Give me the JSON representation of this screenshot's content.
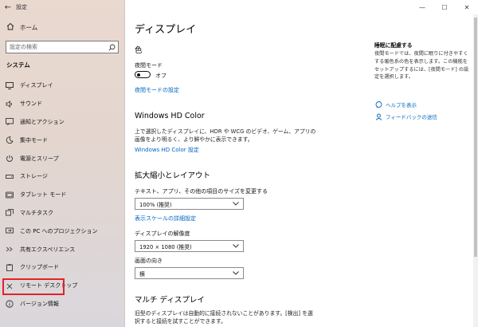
{
  "window": {
    "title": "設定",
    "back_icon": "arrow-left-icon",
    "minimize": "—",
    "maximize": "☐",
    "close": "✕"
  },
  "sidebar": {
    "home_label": "ホーム",
    "search_placeholder": "設定の検索",
    "section": "システム",
    "items": [
      {
        "label": "ディスプレイ",
        "icon": "display-icon"
      },
      {
        "label": "サウンド",
        "icon": "speaker-icon"
      },
      {
        "label": "通知とアクション",
        "icon": "notification-icon"
      },
      {
        "label": "集中モード",
        "icon": "moon-icon"
      },
      {
        "label": "電源とスリープ",
        "icon": "power-icon"
      },
      {
        "label": "ストレージ",
        "icon": "storage-icon"
      },
      {
        "label": "タブレット モード",
        "icon": "tablet-icon"
      },
      {
        "label": "マルチタスク",
        "icon": "multitask-icon"
      },
      {
        "label": "この PC へのプロジェクション",
        "icon": "projection-icon"
      },
      {
        "label": "共有エクスペリエンス",
        "icon": "share-icon"
      },
      {
        "label": "クリップボード",
        "icon": "clipboard-icon"
      },
      {
        "label": "リモート デスクトップ",
        "icon": "remote-desktop-icon",
        "highlighted": true
      },
      {
        "label": "バージョン情報",
        "icon": "info-icon"
      }
    ]
  },
  "main": {
    "title": "ディスプレイ",
    "color_heading": "色",
    "night_light_label": "夜間モード",
    "night_light_state": "オフ",
    "night_light_link": "夜間モードの設定",
    "hdr_heading": "Windows HD Color",
    "hdr_desc": "上で選択したディスプレイに、HDR や WCG のビデオ、ゲーム、アプリの画像をより明るく、より鮮やかに表示できます。",
    "hdr_link": "Windows HD Color 設定",
    "scale_heading": "拡大縮小とレイアウト",
    "scale_label": "テキスト、アプリ、その他の項目のサイズを変更する",
    "scale_value": "100% (推奨)",
    "scale_link": "表示スケールの詳細設定",
    "resolution_label": "ディスプレイの解像度",
    "resolution_value": "1920 × 1080 (推奨)",
    "orientation_label": "画面の向き",
    "orientation_value": "横",
    "multi_heading": "マルチ ディスプレイ",
    "multi_desc": "旧型のディスプレイは自動的に接続されないことがあります。[検出] を選択すると接続を試すことができます。"
  },
  "right_panel": {
    "title": "睡眠に配慮する",
    "desc": "夜間モードでは、夜間に眠りに付きやすくする暖色系の色を表示します。この機能をセットアップするには、[夜間モード] の設定を選択します。",
    "help_link": "ヘルプを表示",
    "feedback_link": "フィードバックの送信"
  }
}
